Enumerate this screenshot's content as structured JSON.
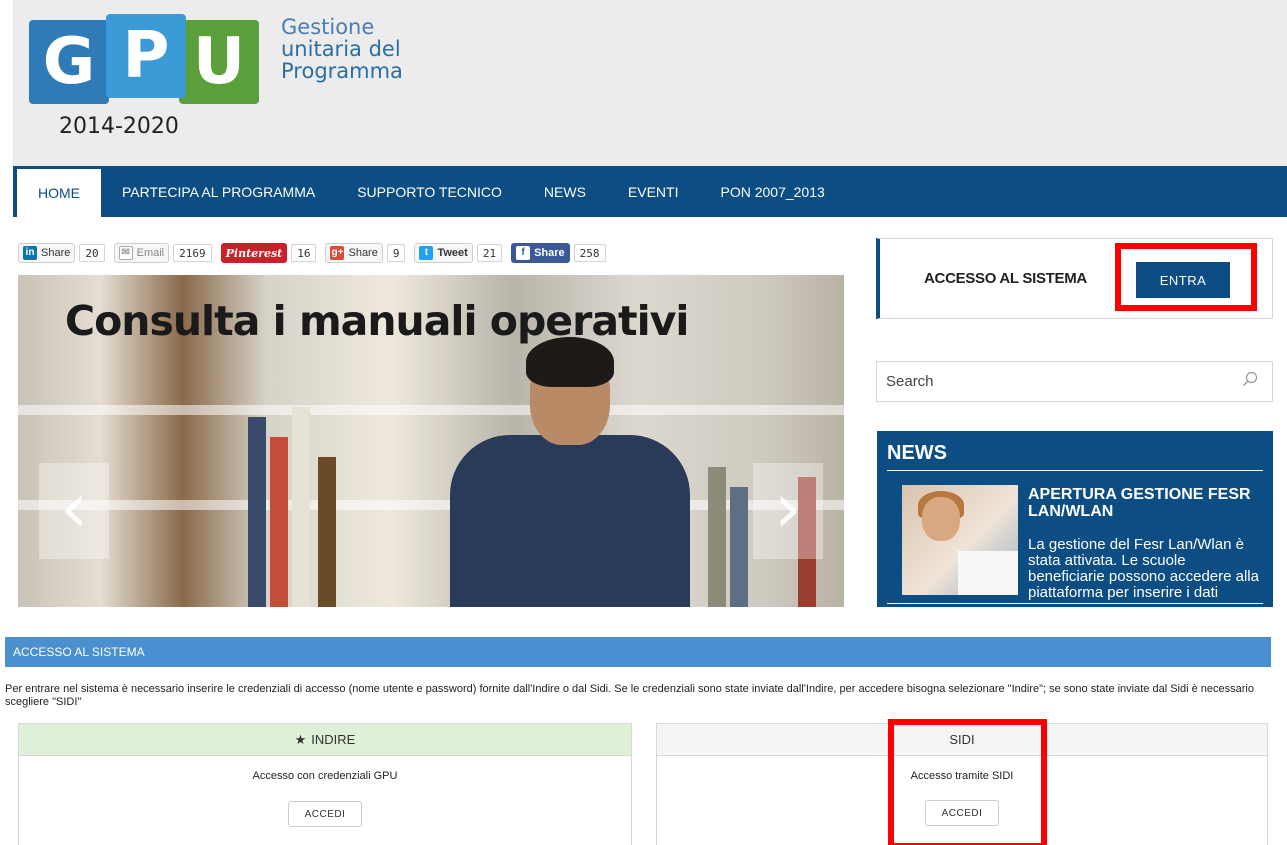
{
  "header": {
    "logo_letters": [
      "G",
      "P",
      "U"
    ],
    "logo_years": "2014-2020",
    "logo_text_lines": [
      "Gestione",
      "unitaria del",
      "Programma"
    ]
  },
  "nav": {
    "items": [
      "HOME",
      "PARTECIPA AL PROGRAMMA",
      "SUPPORTO TECNICO",
      "NEWS",
      "EVENTI",
      "PON 2007_2013"
    ],
    "active": "HOME"
  },
  "social": [
    {
      "icon": "linkedin-icon",
      "label": "Share",
      "count": "20",
      "color": "#0e76a8",
      "glyph": "in"
    },
    {
      "icon": "email-icon",
      "label": "Email",
      "count": "2169",
      "color": "#999999",
      "glyph": "✉"
    },
    {
      "icon": "pinterest-icon",
      "label": "Pinterest",
      "count": "16",
      "color": "#cb2027",
      "glyph": "P"
    },
    {
      "icon": "googleplus-icon",
      "label": "Share",
      "count": "9",
      "color": "#dd4b39",
      "glyph": "g+"
    },
    {
      "icon": "twitter-icon",
      "label": "Tweet",
      "count": "21",
      "color": "#1da1f2",
      "glyph": "t"
    },
    {
      "icon": "facebook-icon",
      "label": "Share",
      "count": "258",
      "color": "#3b5998",
      "glyph": "f"
    }
  ],
  "hero": {
    "title": "Consulta i manuali operativi",
    "prev_glyph": "‹",
    "next_glyph": "›"
  },
  "sidebar": {
    "accesso_label": "ACCESSO AL SISTEMA",
    "entra_label": "ENTRA",
    "search_placeholder": "Search",
    "news_heading": "NEWS",
    "news_title": "APERTURA GESTIONE FESR LAN/WLAN",
    "news_text": "La gestione del Fesr Lan/Wlan è stata attivata. Le scuole beneficiarie possono accedere alla piattaforma per inserire i dati"
  },
  "access": {
    "panel_title": "ACCESSO AL SISTEMA",
    "intro": "Per entrare nel sistema è necessario inserire le credenziali di accesso (nome utente e password) fornite dall'Indire o dal Sidi. Se le credenziali sono state inviate dall'Indire, per accedere bisogna selezionare \"Indire\"; se sono state inviate dal Sidi è necessario scegliere \"SIDI\"",
    "indire": {
      "star": "★",
      "title": "INDIRE",
      "text": "Accesso con credenziali GPU",
      "button": "ACCEDI"
    },
    "sidi": {
      "title": "SIDI",
      "text": "Accesso tramite SIDI",
      "button": "ACCEDI"
    }
  },
  "colors": {
    "nav_bg": "#0c4d84",
    "panel_head": "#4a8fd0",
    "highlight": "#ff0000",
    "indire_head": "#dff0d8"
  }
}
